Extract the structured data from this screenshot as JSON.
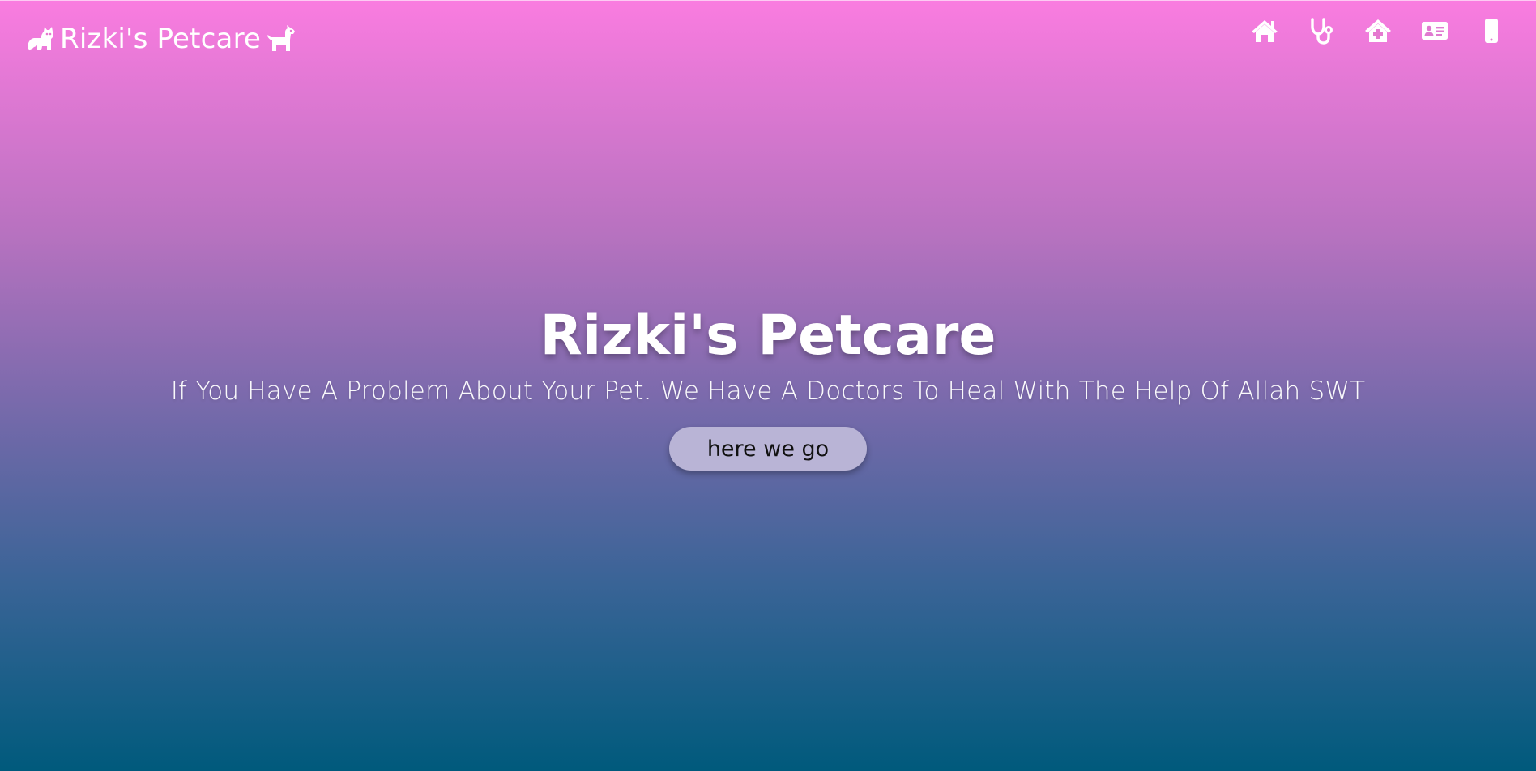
{
  "header": {
    "brand_name": "Rizki's Petcare",
    "brand_left_icon": "cat-icon",
    "brand_right_icon": "dog-icon",
    "nav_icons": [
      "home-icon",
      "stethoscope-icon",
      "clinic-icon",
      "contact-card-icon",
      "mobile-phone-icon"
    ]
  },
  "hero": {
    "title": "Rizki's Petcare",
    "subtitle": "If You Have A Problem About Your Pet. We Have A Doctors To Heal With The Help Of Allah SWT",
    "button_label": "here we go"
  },
  "colors": {
    "gradient_top": "#fa7ce0",
    "gradient_bottom": "#005a7c",
    "button_bg": "#b9b4d6",
    "text": "#ffffff"
  }
}
